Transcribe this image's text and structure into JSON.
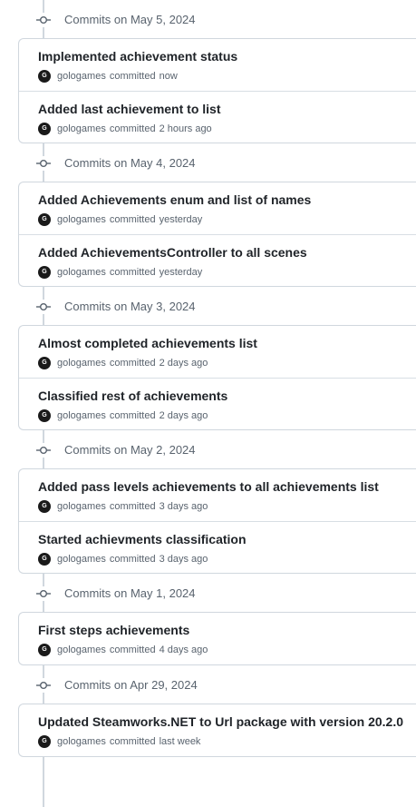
{
  "groups": [
    {
      "label": "Commits on May 5, 2024",
      "commits": [
        {
          "title": "Implemented achievement status",
          "author": "gologames",
          "action": "committed",
          "time": "now",
          "avatar_letter": "G"
        },
        {
          "title": "Added last achievement to list",
          "author": "gologames",
          "action": "committed",
          "time": "2 hours ago",
          "avatar_letter": "G"
        }
      ]
    },
    {
      "label": "Commits on May 4, 2024",
      "commits": [
        {
          "title": "Added Achievements enum and list of names",
          "author": "gologames",
          "action": "committed",
          "time": "yesterday",
          "avatar_letter": "G"
        },
        {
          "title": "Added AchievementsController to all scenes",
          "author": "gologames",
          "action": "committed",
          "time": "yesterday",
          "avatar_letter": "G"
        }
      ]
    },
    {
      "label": "Commits on May 3, 2024",
      "commits": [
        {
          "title": "Almost completed achievements list",
          "author": "gologames",
          "action": "committed",
          "time": "2 days ago",
          "avatar_letter": "G"
        },
        {
          "title": "Classified rest of achievements",
          "author": "gologames",
          "action": "committed",
          "time": "2 days ago",
          "avatar_letter": "G"
        }
      ]
    },
    {
      "label": "Commits on May 2, 2024",
      "commits": [
        {
          "title": "Added pass levels achievements to all achievements list",
          "author": "gologames",
          "action": "committed",
          "time": "3 days ago",
          "avatar_letter": "G"
        },
        {
          "title": "Started achievments classification",
          "author": "gologames",
          "action": "committed",
          "time": "3 days ago",
          "avatar_letter": "G"
        }
      ]
    },
    {
      "label": "Commits on May 1, 2024",
      "commits": [
        {
          "title": "First steps achievements",
          "author": "gologames",
          "action": "committed",
          "time": "4 days ago",
          "avatar_letter": "G"
        }
      ]
    },
    {
      "label": "Commits on Apr 29, 2024",
      "commits": [
        {
          "title": "Updated Steamworks.NET to Url package with version 20.2.0",
          "author": "gologames",
          "action": "committed",
          "time": "last week",
          "avatar_letter": "G"
        }
      ]
    }
  ],
  "colors": {
    "timeline": "#d0d7de",
    "border": "#d0d7de",
    "muted_text": "#59636e",
    "title_text": "#1f2328",
    "avatar_bg": "#1a1a1a"
  },
  "icons": {
    "group_marker": "git-commit-icon",
    "avatar": "user-avatar"
  }
}
